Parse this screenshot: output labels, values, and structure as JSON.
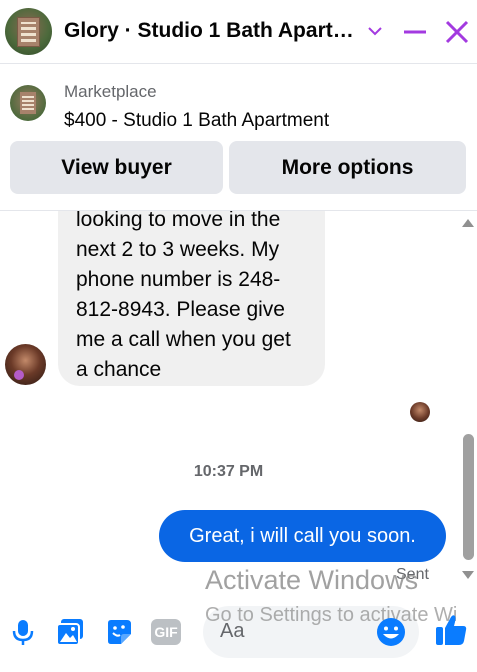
{
  "header": {
    "title": "Glory · Studio 1 Bath Apart…",
    "avatar_icon": "apartment-building-avatar",
    "accent_color": "#a33ae0"
  },
  "marketplace": {
    "label": "Marketplace",
    "listing_title": "$400 - Studio 1 Bath Apartment",
    "buttons": {
      "view_buyer": "View buyer",
      "more_options": "More options"
    }
  },
  "chat": {
    "incoming_message": "looking to move in the\nnext 2 to 3 weeks. My\nphone number is 248-\n812-8943. Please give\nme a call when you get\na chance",
    "timestamp": "10:37 PM",
    "outgoing_message": "Great, i will call you soon.",
    "outgoing_status": "Sent",
    "outgoing_color": "#0a66e4"
  },
  "watermark": {
    "line1": "Activate Windows",
    "line2": "Go to Settings to activate Wi"
  },
  "composer": {
    "placeholder": "Aa",
    "icons": [
      "microphone-icon",
      "photo-icon",
      "sticker-icon",
      "gif-icon",
      "emoji-icon",
      "thumbs-up-icon"
    ],
    "icon_color": "#0a7cff",
    "gif_label": "GIF"
  }
}
